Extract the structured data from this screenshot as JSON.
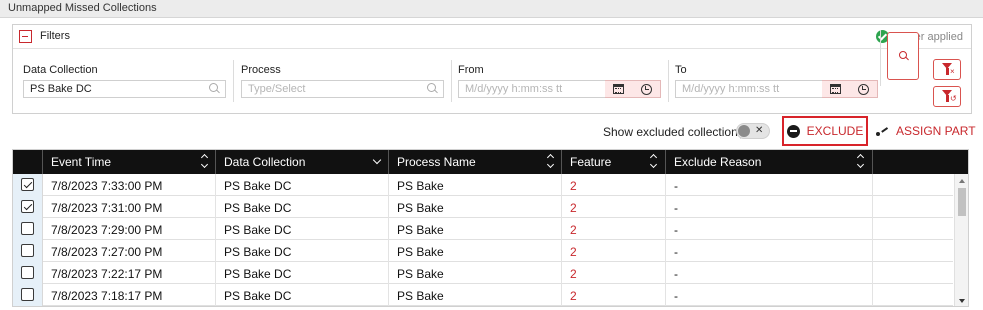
{
  "page": {
    "title": "Unmapped Missed Collections"
  },
  "filters": {
    "title": "Filters",
    "applied_text": "1 filter applied",
    "data_collection": {
      "label": "Data Collection",
      "value": "PS Bake DC"
    },
    "process": {
      "label": "Process",
      "placeholder": "Type/Select"
    },
    "from": {
      "label": "From",
      "placeholder": "M/d/yyyy h:mm:ss tt"
    },
    "to": {
      "label": "To",
      "placeholder": "M/d/yyyy h:mm:ss tt"
    }
  },
  "toolbar": {
    "show_excluded_label": "Show excluded collection(s)",
    "toggle_on": false,
    "toggle_glyph": "✕",
    "exclude_label": "EXCLUDE",
    "assign_label": "ASSIGN PART"
  },
  "grid": {
    "columns": [
      "Event Time",
      "Data Collection",
      "Process Name",
      "Feature",
      "Exclude Reason"
    ],
    "rows": [
      {
        "checked": true,
        "event_time": "7/8/2023 7:33:00 PM",
        "data_collection": "PS Bake DC",
        "process_name": "PS Bake",
        "feature": "2",
        "exclude_reason": "-"
      },
      {
        "checked": true,
        "event_time": "7/8/2023 7:31:00 PM",
        "data_collection": "PS Bake DC",
        "process_name": "PS Bake",
        "feature": "2",
        "exclude_reason": "-"
      },
      {
        "checked": false,
        "event_time": "7/8/2023 7:29:00 PM",
        "data_collection": "PS Bake DC",
        "process_name": "PS Bake",
        "feature": "2",
        "exclude_reason": "-"
      },
      {
        "checked": false,
        "event_time": "7/8/2023 7:27:00 PM",
        "data_collection": "PS Bake DC",
        "process_name": "PS Bake",
        "feature": "2",
        "exclude_reason": "-"
      },
      {
        "checked": false,
        "event_time": "7/8/2023 7:22:17 PM",
        "data_collection": "PS Bake DC",
        "process_name": "PS Bake",
        "feature": "2",
        "exclude_reason": "-"
      },
      {
        "checked": false,
        "event_time": "7/8/2023 7:18:17 PM",
        "data_collection": "PS Bake DC",
        "process_name": "PS Bake",
        "feature": "2",
        "exclude_reason": "-"
      }
    ]
  },
  "colors": {
    "accent": "#c8282d",
    "header_bg": "#111111",
    "success": "#2ea44f",
    "selection_col": "#e6f0f8"
  }
}
